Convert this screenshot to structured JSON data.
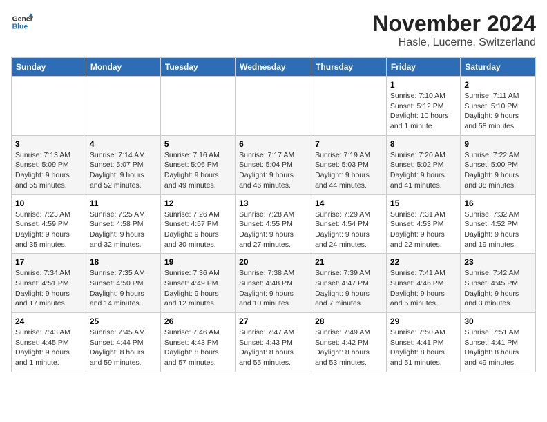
{
  "logo": {
    "line1": "General",
    "line2": "Blue"
  },
  "title": "November 2024",
  "location": "Hasle, Lucerne, Switzerland",
  "weekdays": [
    "Sunday",
    "Monday",
    "Tuesday",
    "Wednesday",
    "Thursday",
    "Friday",
    "Saturday"
  ],
  "weeks": [
    [
      {
        "day": "",
        "info": ""
      },
      {
        "day": "",
        "info": ""
      },
      {
        "day": "",
        "info": ""
      },
      {
        "day": "",
        "info": ""
      },
      {
        "day": "",
        "info": ""
      },
      {
        "day": "1",
        "info": "Sunrise: 7:10 AM\nSunset: 5:12 PM\nDaylight: 10 hours and 1 minute."
      },
      {
        "day": "2",
        "info": "Sunrise: 7:11 AM\nSunset: 5:10 PM\nDaylight: 9 hours and 58 minutes."
      }
    ],
    [
      {
        "day": "3",
        "info": "Sunrise: 7:13 AM\nSunset: 5:09 PM\nDaylight: 9 hours and 55 minutes."
      },
      {
        "day": "4",
        "info": "Sunrise: 7:14 AM\nSunset: 5:07 PM\nDaylight: 9 hours and 52 minutes."
      },
      {
        "day": "5",
        "info": "Sunrise: 7:16 AM\nSunset: 5:06 PM\nDaylight: 9 hours and 49 minutes."
      },
      {
        "day": "6",
        "info": "Sunrise: 7:17 AM\nSunset: 5:04 PM\nDaylight: 9 hours and 46 minutes."
      },
      {
        "day": "7",
        "info": "Sunrise: 7:19 AM\nSunset: 5:03 PM\nDaylight: 9 hours and 44 minutes."
      },
      {
        "day": "8",
        "info": "Sunrise: 7:20 AM\nSunset: 5:02 PM\nDaylight: 9 hours and 41 minutes."
      },
      {
        "day": "9",
        "info": "Sunrise: 7:22 AM\nSunset: 5:00 PM\nDaylight: 9 hours and 38 minutes."
      }
    ],
    [
      {
        "day": "10",
        "info": "Sunrise: 7:23 AM\nSunset: 4:59 PM\nDaylight: 9 hours and 35 minutes."
      },
      {
        "day": "11",
        "info": "Sunrise: 7:25 AM\nSunset: 4:58 PM\nDaylight: 9 hours and 32 minutes."
      },
      {
        "day": "12",
        "info": "Sunrise: 7:26 AM\nSunset: 4:57 PM\nDaylight: 9 hours and 30 minutes."
      },
      {
        "day": "13",
        "info": "Sunrise: 7:28 AM\nSunset: 4:55 PM\nDaylight: 9 hours and 27 minutes."
      },
      {
        "day": "14",
        "info": "Sunrise: 7:29 AM\nSunset: 4:54 PM\nDaylight: 9 hours and 24 minutes."
      },
      {
        "day": "15",
        "info": "Sunrise: 7:31 AM\nSunset: 4:53 PM\nDaylight: 9 hours and 22 minutes."
      },
      {
        "day": "16",
        "info": "Sunrise: 7:32 AM\nSunset: 4:52 PM\nDaylight: 9 hours and 19 minutes."
      }
    ],
    [
      {
        "day": "17",
        "info": "Sunrise: 7:34 AM\nSunset: 4:51 PM\nDaylight: 9 hours and 17 minutes."
      },
      {
        "day": "18",
        "info": "Sunrise: 7:35 AM\nSunset: 4:50 PM\nDaylight: 9 hours and 14 minutes."
      },
      {
        "day": "19",
        "info": "Sunrise: 7:36 AM\nSunset: 4:49 PM\nDaylight: 9 hours and 12 minutes."
      },
      {
        "day": "20",
        "info": "Sunrise: 7:38 AM\nSunset: 4:48 PM\nDaylight: 9 hours and 10 minutes."
      },
      {
        "day": "21",
        "info": "Sunrise: 7:39 AM\nSunset: 4:47 PM\nDaylight: 9 hours and 7 minutes."
      },
      {
        "day": "22",
        "info": "Sunrise: 7:41 AM\nSunset: 4:46 PM\nDaylight: 9 hours and 5 minutes."
      },
      {
        "day": "23",
        "info": "Sunrise: 7:42 AM\nSunset: 4:45 PM\nDaylight: 9 hours and 3 minutes."
      }
    ],
    [
      {
        "day": "24",
        "info": "Sunrise: 7:43 AM\nSunset: 4:45 PM\nDaylight: 9 hours and 1 minute."
      },
      {
        "day": "25",
        "info": "Sunrise: 7:45 AM\nSunset: 4:44 PM\nDaylight: 8 hours and 59 minutes."
      },
      {
        "day": "26",
        "info": "Sunrise: 7:46 AM\nSunset: 4:43 PM\nDaylight: 8 hours and 57 minutes."
      },
      {
        "day": "27",
        "info": "Sunrise: 7:47 AM\nSunset: 4:43 PM\nDaylight: 8 hours and 55 minutes."
      },
      {
        "day": "28",
        "info": "Sunrise: 7:49 AM\nSunset: 4:42 PM\nDaylight: 8 hours and 53 minutes."
      },
      {
        "day": "29",
        "info": "Sunrise: 7:50 AM\nSunset: 4:41 PM\nDaylight: 8 hours and 51 minutes."
      },
      {
        "day": "30",
        "info": "Sunrise: 7:51 AM\nSunset: 4:41 PM\nDaylight: 8 hours and 49 minutes."
      }
    ]
  ]
}
